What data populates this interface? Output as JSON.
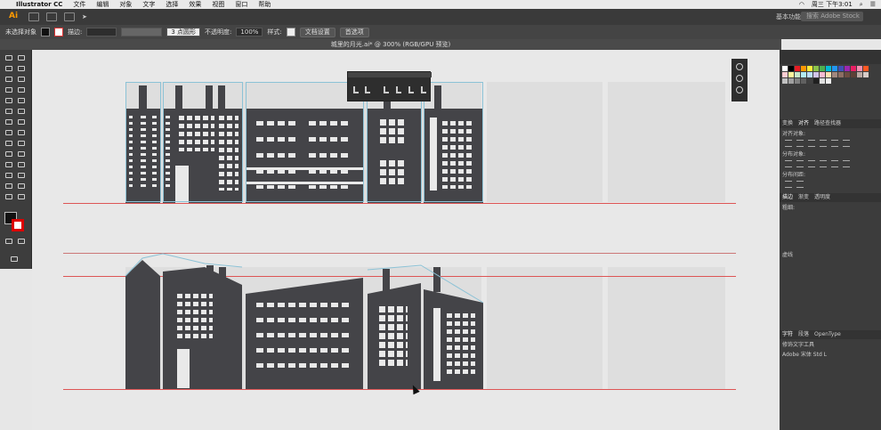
{
  "menubar": {
    "app": "Illustrator CC",
    "items": [
      "文件",
      "编辑",
      "对象",
      "文字",
      "选择",
      "效果",
      "视图",
      "窗口",
      "帮助"
    ],
    "clock": "周三 下午3:01"
  },
  "appbar": {
    "logo": "Ai",
    "workspace": "基本功能",
    "search_placeholder": "搜索 Adobe Stock"
  },
  "control": {
    "no_selection": "未选择对象",
    "stroke_label": "描边:",
    "brush": "3 点圆形",
    "opacity_label": "不透明度:",
    "opacity": "100%",
    "style_label": "样式:",
    "doc_setup": "文档设置",
    "prefs": "首选项"
  },
  "doc_tab": "城里的月光.ai* @ 300% (RGB/GPU 预览)",
  "panel": {
    "transform_tab": "变换",
    "align_tab": "对齐",
    "pathfinder_tab": "路径查找器",
    "align_objects": "对齐对象:",
    "distribute_objects": "分布对象:",
    "distribute_spacing": "分布间距:",
    "stroke_tab": "描边",
    "gradient_tab": "渐变",
    "transparency_tab": "透明度",
    "weight_label": "粗细:",
    "dashed_label": "虚线",
    "char_tab": "字符",
    "para_tab": "段落",
    "opentype_tab": "OpenType",
    "touch_type": "修饰文字工具",
    "font_name": "Adobe 宋体 Std L"
  },
  "colors": {
    "accent": "#ff9a00",
    "building": "#444448",
    "guide_red": "#dd5555"
  },
  "swatches": [
    "#ffffff",
    "#000000",
    "#e51c23",
    "#ff9800",
    "#ffeb3b",
    "#8bc34a",
    "#4caf50",
    "#00bcd4",
    "#2196f3",
    "#3f51b5",
    "#9c27b0",
    "#e91e63",
    "#f48fb1",
    "#ff5722",
    "#ffcdd2",
    "#fff59d",
    "#c8e6c9",
    "#b2ebf2",
    "#bbdefb",
    "#d1c4e9",
    "#f8bbd0",
    "#ffe0b2",
    "#a1887f",
    "#8d6e63",
    "#6d4c41",
    "#5d4037",
    "#bcaaa4",
    "#d7ccc8",
    "#c0c0c0",
    "#a0a0a0",
    "#808080",
    "#606060",
    "#404040",
    "#202020",
    "#e0e0e0",
    "#f0f0f0"
  ]
}
